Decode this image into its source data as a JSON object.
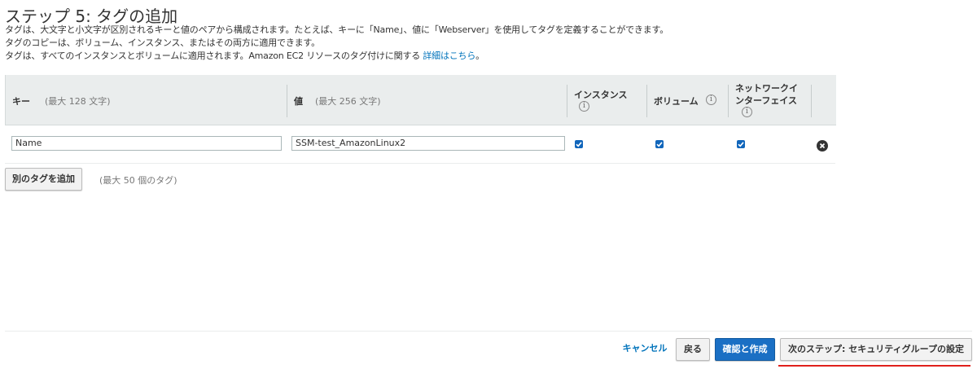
{
  "page": {
    "title": "ステップ 5: タグの追加",
    "description": [
      "タグは、大文字と小文字が区別されるキーと値のペアから構成されます。たとえば、キーに「Name」、値に「Webserver」を使用してタグを定義することができます。",
      "タグのコピーは、ボリューム、インスタンス、またはその両方に適用できます。",
      "タグは、すべてのインスタンスとボリュームに適用されます。Amazon EC2 リソースのタグ付けに関する"
    ],
    "details_link": "詳細はこちら",
    "details_suffix": "。"
  },
  "table": {
    "headers": {
      "key": "キー",
      "key_hint": "(最大 128 文字)",
      "value": "値",
      "value_hint": "(最大 256 文字)",
      "instances_line1": "インスタンス",
      "volumes": "ボリューム",
      "network_line1": "ネットワークイ",
      "network_line2": "ンターフェイス"
    },
    "rows": [
      {
        "key": "Name",
        "value": "SSM-test_AmazonLinux2",
        "instances": true,
        "volumes": true,
        "network_interfaces": true
      }
    ]
  },
  "add_tag": {
    "button": "別のタグを追加",
    "hint": "(最大 50 個のタグ)"
  },
  "footer": {
    "cancel": "キャンセル",
    "back": "戻る",
    "review_launch": "確認と作成",
    "next": "次のステップ: セキュリティグループの設定"
  },
  "colors": {
    "primary_button": "#1a6fc4",
    "link": "#0073bb",
    "checkbox": "#1166bb",
    "highlight": "#e0201c"
  },
  "icons": {
    "info": "info-icon",
    "remove": "remove-circle-icon",
    "check": "checkmark-icon"
  }
}
